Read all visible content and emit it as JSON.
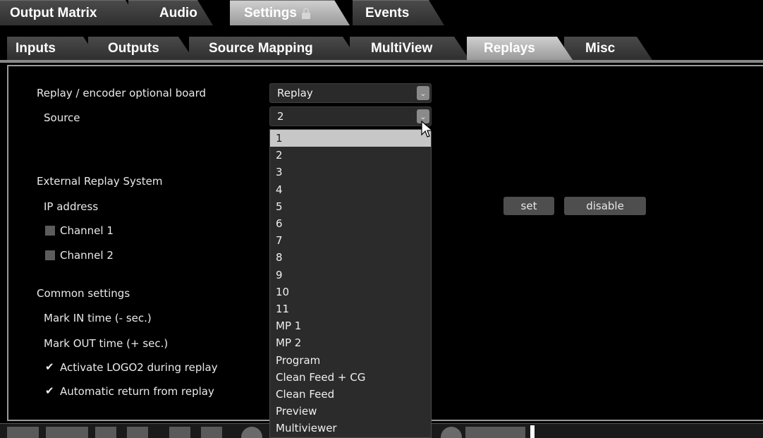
{
  "top_tabs": [
    {
      "label": "Output Matrix",
      "active": false
    },
    {
      "label": "Audio",
      "active": false
    },
    {
      "label": "Settings",
      "active": true,
      "icon": "lock-icon"
    },
    {
      "label": "Events",
      "active": false
    }
  ],
  "sub_tabs": [
    {
      "label": "Inputs",
      "active": false
    },
    {
      "label": "Outputs",
      "active": false
    },
    {
      "label": "Source Mapping",
      "active": false
    },
    {
      "label": "MultiView",
      "active": false
    },
    {
      "label": "Replays",
      "active": true
    },
    {
      "label": "Misc",
      "active": false
    }
  ],
  "replay": {
    "board_label": "Replay / encoder optional board",
    "board_value": "Replay",
    "source_label": "Source",
    "source_value": "2"
  },
  "external": {
    "section_label": "External Replay System",
    "ip_label": "IP address",
    "channel1_label": "Channel 1",
    "channel2_label": "Channel 2",
    "set_label": "set",
    "disable_label": "disable"
  },
  "common": {
    "section_label": "Common settings",
    "mark_in_label": "Mark IN time (- sec.)",
    "mark_out_label": "Mark OUT time (+ sec.)",
    "logo2_label": "Activate LOGO2 during replay",
    "logo2_checked": true,
    "auto_return_label": "Automatic return from replay",
    "auto_return_checked": true
  },
  "source_options": [
    "1",
    "2",
    "3",
    "4",
    "5",
    "6",
    "7",
    "8",
    "9",
    "10",
    "11",
    "MP 1",
    "MP 2",
    "Program",
    "Clean Feed + CG",
    "Clean Feed",
    "Preview",
    "Multiviewer"
  ],
  "hovered_option": "1",
  "colors": {
    "active_tab": "#b5b5b5",
    "inactive_tab": "#3c3c3c",
    "dropdown_bg": "#2b2b2b",
    "hover_bg": "#c7c7c7"
  }
}
